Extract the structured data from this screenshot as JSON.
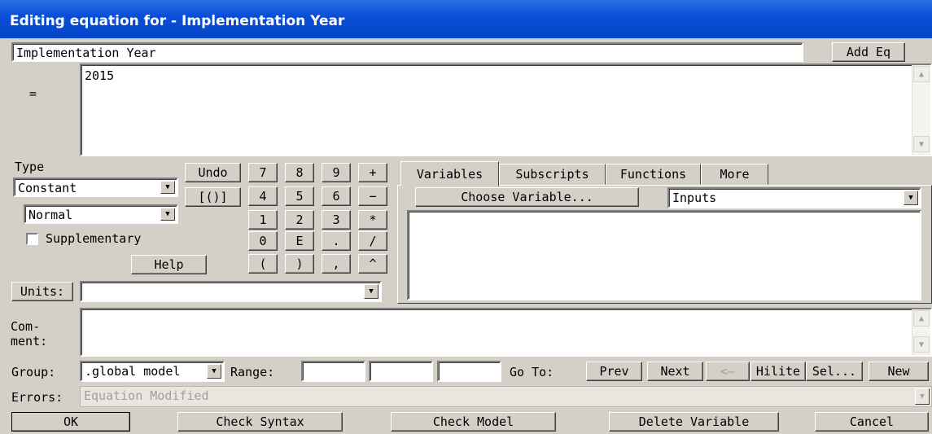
{
  "window": {
    "title": "Editing equation for - Implementation Year"
  },
  "name_field": {
    "value": "Implementation Year",
    "add_eq_label": "Add Eq"
  },
  "equation": {
    "equals_label": "=",
    "value": "2015"
  },
  "type_section": {
    "label": "Type",
    "type_value": "Constant",
    "subtype_value": "Normal",
    "supplementary_label": "Supplementary",
    "supplementary_checked": false,
    "help_label": "Help"
  },
  "keypad": {
    "undo_label": "Undo",
    "bracket_label": "[()]",
    "keys": [
      "7",
      "8",
      "9",
      "+",
      "4",
      "5",
      "6",
      "−",
      "1",
      "2",
      "3",
      "*",
      "0",
      "E",
      ".",
      "/",
      "(",
      ")",
      ",",
      "^"
    ]
  },
  "units": {
    "label": "Units:",
    "value": ""
  },
  "tabs": {
    "items": [
      "Variables",
      "Subscripts",
      "Functions",
      "More"
    ],
    "active": "Variables",
    "choose_variable_label": "Choose Variable...",
    "filter_value": "Inputs"
  },
  "comment": {
    "label_line1": "Com-",
    "label_line2": "ment:",
    "value": ""
  },
  "group_row": {
    "group_label": "Group:",
    "group_value": ".global model",
    "range_label": "Range:",
    "goto_label": "Go To:",
    "prev_label": "Prev",
    "next_label": "Next",
    "back_label": "<—",
    "hilite_label": "Hilite",
    "sel_label": "Sel...",
    "new_label": "New"
  },
  "errors": {
    "label": "Errors:",
    "value": "Equation Modified"
  },
  "footer": {
    "ok_label": "OK",
    "check_syntax_label": "Check Syntax",
    "check_model_label": "Check Model",
    "delete_variable_label": "Delete Variable",
    "cancel_label": "Cancel"
  },
  "colors": {
    "titlebar": "#0a4fd8",
    "face": "#d4d0c8"
  }
}
